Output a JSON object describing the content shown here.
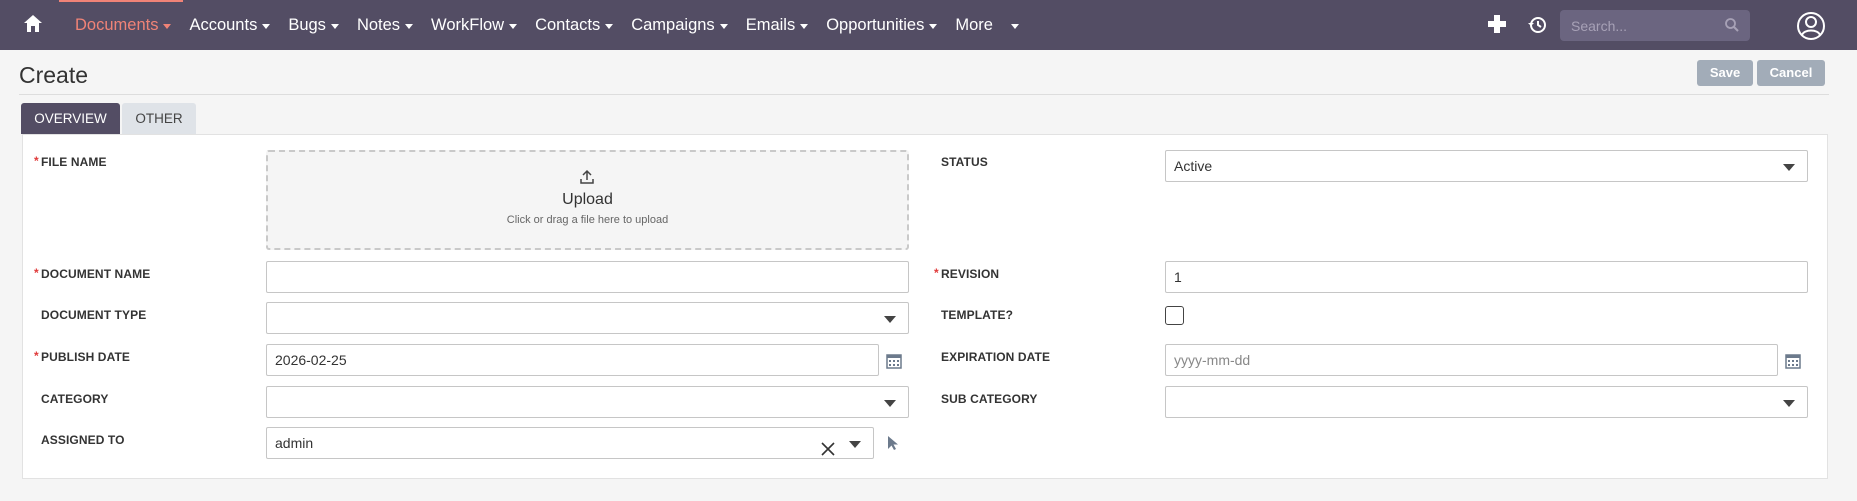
{
  "nav": {
    "menu": [
      {
        "label": "Documents",
        "active": true
      },
      {
        "label": "Accounts"
      },
      {
        "label": "Bugs"
      },
      {
        "label": "Notes"
      },
      {
        "label": "WorkFlow"
      },
      {
        "label": "Contacts"
      },
      {
        "label": "Campaigns"
      },
      {
        "label": "Emails"
      },
      {
        "label": "Opportunities"
      },
      {
        "label": "More"
      }
    ],
    "search_placeholder": "Search...",
    "icons": [
      "home-icon",
      "plus-icon",
      "history-icon",
      "search-icon",
      "user-icon"
    ],
    "colors": {
      "bar": "#534d64",
      "active": "#f08377"
    }
  },
  "page": {
    "title": "Create",
    "save_label": "Save",
    "cancel_label": "Cancel"
  },
  "tabs": [
    {
      "label": "OVERVIEW",
      "active": true
    },
    {
      "label": "OTHER",
      "active": false
    }
  ],
  "form": {
    "file_name": {
      "label": "FILE NAME",
      "required": true,
      "upload_title": "Upload",
      "upload_hint": "Click or drag a file here to upload"
    },
    "status": {
      "label": "STATUS",
      "value": "Active"
    },
    "document_name": {
      "label": "DOCUMENT NAME",
      "required": true,
      "value": ""
    },
    "revision": {
      "label": "REVISION",
      "required": true,
      "value": "1"
    },
    "document_type": {
      "label": "DOCUMENT TYPE",
      "value": ""
    },
    "template": {
      "label": "TEMPLATE?",
      "checked": false
    },
    "publish_date": {
      "label": "PUBLISH DATE",
      "required": true,
      "value": "2026-02-25"
    },
    "expiration_date": {
      "label": "EXPIRATION DATE",
      "placeholder": "yyyy-mm-dd"
    },
    "category": {
      "label": "CATEGORY",
      "value": ""
    },
    "sub_category": {
      "label": "SUB CATEGORY",
      "value": ""
    },
    "assigned_to": {
      "label": "ASSIGNED TO",
      "value": "admin"
    }
  }
}
